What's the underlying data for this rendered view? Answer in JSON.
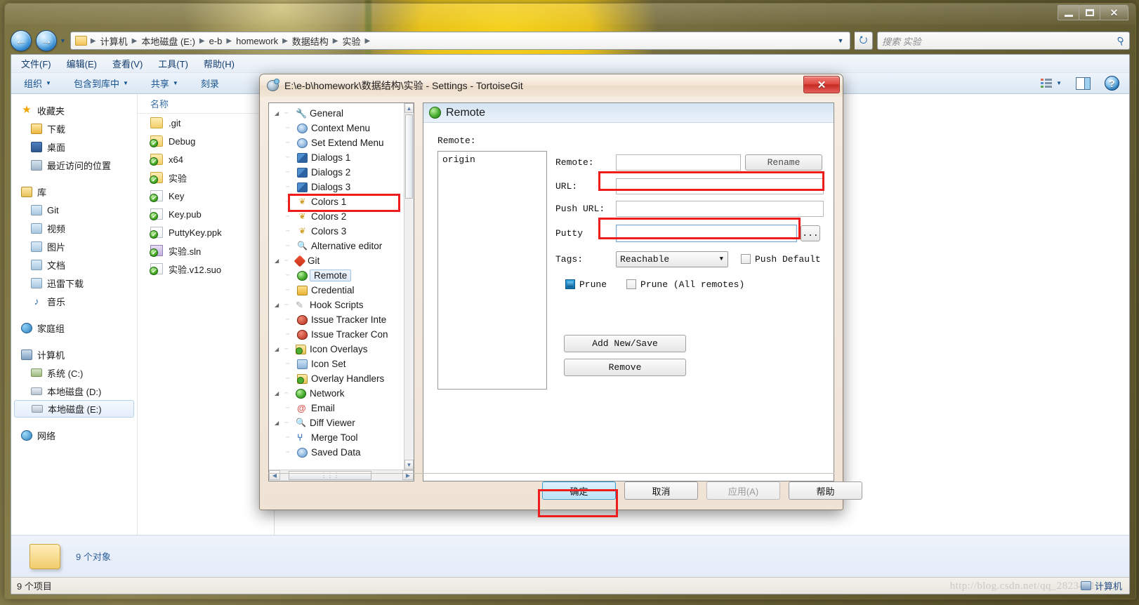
{
  "explorer": {
    "window_controls": {
      "minimize": "minimize-icon",
      "maximize": "maximize-icon",
      "close": "✕"
    },
    "breadcrumb": [
      "计算机",
      "本地磁盘 (E:)",
      "e-b",
      "homework",
      "数据结构",
      "实验"
    ],
    "search": {
      "placeholder": "搜索 实验"
    },
    "menubar": [
      "文件(F)",
      "编辑(E)",
      "查看(V)",
      "工具(T)",
      "帮助(H)"
    ],
    "toolbar": [
      "组织",
      "包含到库中",
      "共享",
      "刻录"
    ],
    "navpane": {
      "groups": [
        {
          "title": "收藏夹",
          "icon": "star-icon",
          "items": [
            {
              "label": "下载",
              "icon": "download-folder-icon"
            },
            {
              "label": "桌面",
              "icon": "desktop-icon"
            },
            {
              "label": "最近访问的位置",
              "icon": "recent-places-icon"
            }
          ]
        },
        {
          "title": "库",
          "icon": "library-icon",
          "items": [
            {
              "label": "Git",
              "icon": "library-shelf-icon"
            },
            {
              "label": "视频",
              "icon": "video-library-icon"
            },
            {
              "label": "图片",
              "icon": "pictures-library-icon"
            },
            {
              "label": "文档",
              "icon": "documents-library-icon"
            },
            {
              "label": "迅雷下载",
              "icon": "thunder-download-icon"
            },
            {
              "label": "音乐",
              "icon": "music-library-icon"
            }
          ]
        },
        {
          "title": "家庭组",
          "icon": "homegroup-icon",
          "items": []
        },
        {
          "title": "计算机",
          "icon": "computer-icon",
          "items": [
            {
              "label": "系统 (C:)",
              "icon": "system-drive-icon",
              "selected": false
            },
            {
              "label": "本地磁盘 (D:)",
              "icon": "drive-icon",
              "selected": false
            },
            {
              "label": "本地磁盘 (E:)",
              "icon": "drive-icon",
              "selected": true
            }
          ]
        },
        {
          "title": "网络",
          "icon": "network-icon",
          "items": []
        }
      ]
    },
    "list": {
      "header": "名称",
      "files": [
        {
          "name": ".git",
          "type": "folder",
          "overlay": false
        },
        {
          "name": "Debug",
          "type": "folder",
          "overlay": true
        },
        {
          "name": "x64",
          "type": "folder",
          "overlay": true
        },
        {
          "name": "实验",
          "type": "folder",
          "overlay": true
        },
        {
          "name": "Key",
          "type": "file",
          "overlay": true
        },
        {
          "name": "Key.pub",
          "type": "file",
          "overlay": true
        },
        {
          "name": "PuttyKey.ppk",
          "type": "file",
          "overlay": true
        },
        {
          "name": "实验.sln",
          "type": "sln",
          "overlay": true
        },
        {
          "name": "实验.v12.suo",
          "type": "file",
          "overlay": true
        }
      ]
    },
    "details": {
      "text": "9 个对象"
    },
    "statusbar": {
      "left": "9 个项目",
      "right": "计算机"
    },
    "watermark": "http://blog.csdn.net/qq_28234213"
  },
  "dialog": {
    "title": "E:\\e-b\\homework\\数据结构\\实验 - Settings - TortoiseGit",
    "close_label": "✕",
    "tree": [
      {
        "label": "General",
        "level": 0,
        "icon": "wrench-icon",
        "expander": "▲"
      },
      {
        "label": "Context Menu",
        "level": 1,
        "icon": "gear-icon"
      },
      {
        "label": "Set Extend Menu",
        "level": 1,
        "icon": "gear-icon"
      },
      {
        "label": "Dialogs 1",
        "level": 1,
        "icon": "dialogs-icon"
      },
      {
        "label": "Dialogs 2",
        "level": 1,
        "icon": "dialogs-icon"
      },
      {
        "label": "Dialogs 3",
        "level": 1,
        "icon": "dialogs-icon"
      },
      {
        "label": "Colors 1",
        "level": 1,
        "icon": "colors-icon"
      },
      {
        "label": "Colors 2",
        "level": 1,
        "icon": "colors-icon"
      },
      {
        "label": "Colors 3",
        "level": 1,
        "icon": "colors-icon"
      },
      {
        "label": "Alternative editor",
        "level": 1,
        "icon": "magnifier-pencil-icon"
      },
      {
        "label": "Git",
        "level": 0,
        "icon": "git-icon",
        "expander": "▲"
      },
      {
        "label": "Remote",
        "level": 1,
        "icon": "remote-globe-icon",
        "selected": true
      },
      {
        "label": "Credential",
        "level": 1,
        "icon": "credential-lock-icon"
      },
      {
        "label": "Hook Scripts",
        "level": 0,
        "icon": "hook-scripts-icon",
        "expander": "▲"
      },
      {
        "label": "Issue Tracker Inte",
        "level": 1,
        "icon": "bug-icon"
      },
      {
        "label": "Issue Tracker Con",
        "level": 1,
        "icon": "bug-icon"
      },
      {
        "label": "Icon Overlays",
        "level": 0,
        "icon": "icon-overlays-icon",
        "expander": "▲"
      },
      {
        "label": "Icon Set",
        "level": 1,
        "icon": "icon-set-icon"
      },
      {
        "label": "Overlay Handlers",
        "level": 1,
        "icon": "icon-overlays-icon"
      },
      {
        "label": "Network",
        "level": 0,
        "icon": "network-globe-icon",
        "expander": "▲"
      },
      {
        "label": "Email",
        "level": 1,
        "icon": "email-at-icon"
      },
      {
        "label": "Diff Viewer",
        "level": 0,
        "icon": "magnifier-pencil-icon",
        "expander": "▲"
      },
      {
        "label": "Merge Tool",
        "level": 1,
        "icon": "merge-icon"
      },
      {
        "label": "Saved Data",
        "level": 0,
        "icon": "gear-icon"
      }
    ],
    "page": {
      "title": "Remote",
      "remote_list_label": "Remote:",
      "remote_list_items": [
        "origin"
      ],
      "fields": {
        "remote_label": "Remote:",
        "remote_value": "",
        "rename_label": "Rename",
        "url_label": "URL:",
        "url_value": "",
        "push_url_label": "Push URL:",
        "push_url_value": "",
        "putty_label": "Putty",
        "putty_value": "",
        "browse_label": "...",
        "tags_label": "Tags:",
        "tags_value": "Reachable",
        "push_default_label": "Push Default",
        "push_default_checked": false,
        "prune_label": "Prune",
        "prune_checked": true,
        "prune_all_label": "Prune (All remotes)",
        "prune_all_checked": false
      },
      "actions": {
        "add_new_save": "Add New/Save",
        "remove": "Remove"
      }
    },
    "buttons": {
      "ok": "确定",
      "cancel": "取消",
      "apply": "应用(A)",
      "help": "帮助"
    }
  }
}
